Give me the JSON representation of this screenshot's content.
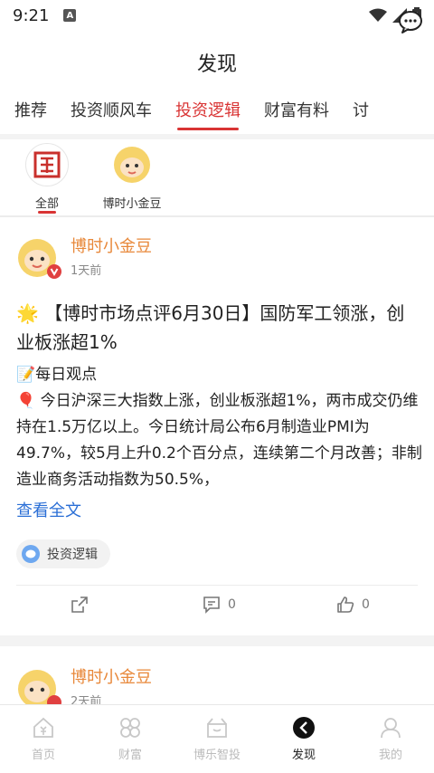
{
  "status": {
    "time": "9:21",
    "a_label": "A"
  },
  "header": {
    "title": "发现"
  },
  "tabs": [
    "推荐",
    "投资顺风车",
    "投资逻辑",
    "财富有料",
    "讨"
  ],
  "filters": [
    {
      "label": "全部",
      "active": true
    },
    {
      "label": "博时小金豆",
      "active": false
    }
  ],
  "post1": {
    "author": "博时小金豆",
    "time": "1天前",
    "title": "🌟 【博时市场点评6月30日】国防军工领涨，创业板涨超1%",
    "line1": "📝每日观点",
    "body": "🎈 今日沪深三大指数上涨，创业板涨超1%，两市成交仍维持在1.5万亿以上。今日统计局公布6月制造业PMI为49.7%，较5月上升0.2个百分点，连续第二个月改善；非制造业商务活动指数为50.5%，",
    "more": "查看全文",
    "tag": "投资逻辑",
    "comments": "0",
    "likes": "0"
  },
  "post2": {
    "author": "博时小金豆",
    "time": "2天前"
  },
  "bottom_nav": [
    {
      "label": "首页",
      "icon": "home-icon"
    },
    {
      "label": "财富",
      "icon": "wealth-icon"
    },
    {
      "label": "博乐智投",
      "icon": "gift-icon"
    },
    {
      "label": "发现",
      "icon": "discover-icon"
    },
    {
      "label": "我的",
      "icon": "user-icon"
    }
  ],
  "colors": {
    "accent": "#d93434",
    "author": "#e8883a",
    "link": "#2b6fd6"
  }
}
